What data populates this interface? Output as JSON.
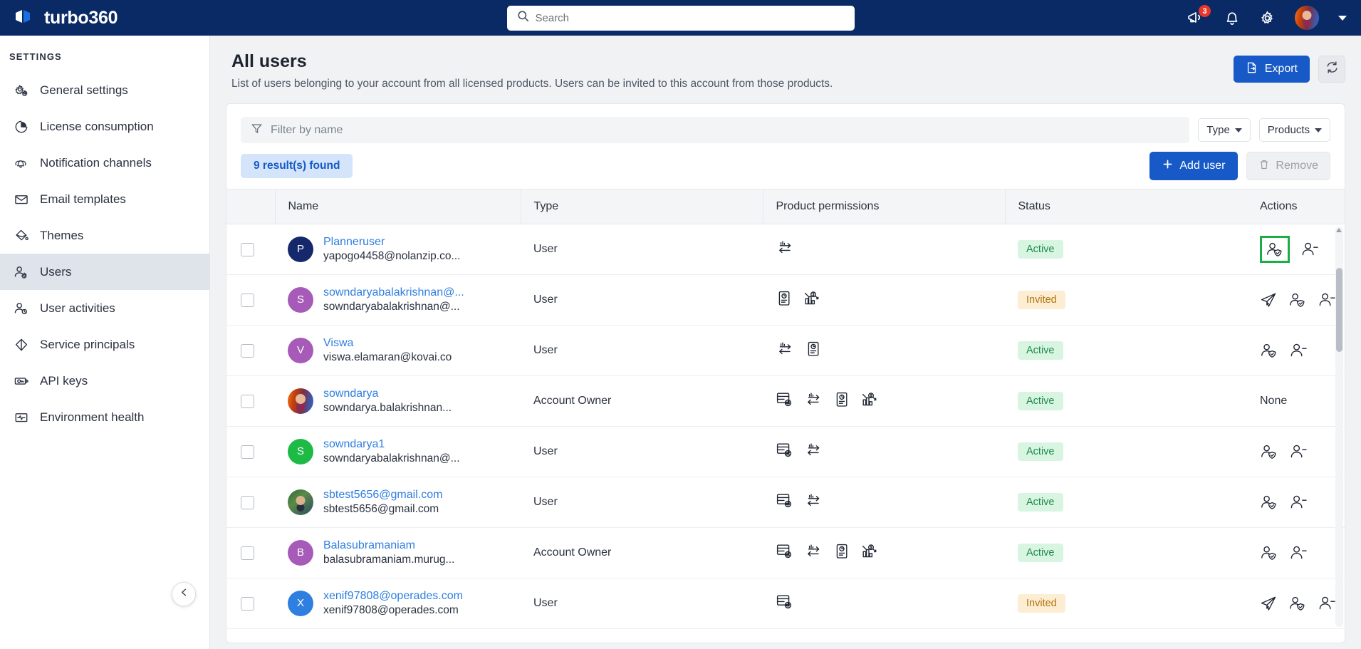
{
  "topbar": {
    "brand": "turbo360",
    "search_placeholder": "Search",
    "announcement_badge": "3"
  },
  "sidebar": {
    "section_label": "SETTINGS",
    "items": [
      {
        "label": "General settings",
        "icon": "gears-icon",
        "active": false
      },
      {
        "label": "License consumption",
        "icon": "pie-chart-icon",
        "active": false
      },
      {
        "label": "Notification channels",
        "icon": "notification-icon",
        "active": false
      },
      {
        "label": "Email templates",
        "icon": "envelope-icon",
        "active": false
      },
      {
        "label": "Themes",
        "icon": "palette-icon",
        "active": false
      },
      {
        "label": "Users",
        "icon": "user-gear-icon",
        "active": true
      },
      {
        "label": "User activities",
        "icon": "user-clock-icon",
        "active": false
      },
      {
        "label": "Service principals",
        "icon": "diamond-icon",
        "active": false
      },
      {
        "label": "API keys",
        "icon": "key-card-icon",
        "active": false
      },
      {
        "label": "Environment health",
        "icon": "health-monitor-icon",
        "active": false
      }
    ]
  },
  "page": {
    "title": "All users",
    "subtitle": "List of users belonging to your account from all licensed products. Users can be invited to this account from those products.",
    "export_label": "Export",
    "refresh_icon": "refresh-icon"
  },
  "filter": {
    "placeholder": "Filter by name",
    "value": "",
    "type_label": "Type",
    "products_label": "Products"
  },
  "toolbar": {
    "result_count": "9 result(s) found",
    "add_user_label": "Add user",
    "remove_label": "Remove"
  },
  "table": {
    "columns": [
      "Name",
      "Type",
      "Product permissions",
      "Status",
      "Actions"
    ],
    "rows": [
      {
        "initial": "P",
        "avatar_color": "#14286b",
        "avatar_kind": "initial",
        "name": "Planneruser",
        "email": "yapogo4458@nolanzip.co...",
        "type": "User",
        "permissions": [
          "integrate-icon"
        ],
        "status": "Active",
        "status_kind": "active",
        "actions": [
          "manage-permissions-icon",
          "remove-user-icon"
        ],
        "highlight_action": 0,
        "actions_text": ""
      },
      {
        "initial": "S",
        "avatar_color": "#a75bb8",
        "avatar_kind": "initial",
        "name": "sowndaryabalakrishnan@...",
        "email": "sowndaryabalakrishnan@...",
        "type": "User",
        "permissions": [
          "document-icon",
          "finops-icon"
        ],
        "status": "Invited",
        "status_kind": "invited",
        "actions": [
          "resend-invite-icon",
          "manage-permissions-icon",
          "remove-user-icon"
        ],
        "highlight_action": -1,
        "actions_text": ""
      },
      {
        "initial": "V",
        "avatar_color": "#a75bb8",
        "avatar_kind": "initial",
        "name": "Viswa",
        "email": "viswa.elamaran@kovai.co",
        "type": "User",
        "permissions": [
          "integrate-icon",
          "document-icon"
        ],
        "status": "Active",
        "status_kind": "active",
        "actions": [
          "manage-permissions-icon",
          "remove-user-icon"
        ],
        "highlight_action": -1,
        "actions_text": ""
      },
      {
        "initial": "",
        "avatar_color": "",
        "avatar_kind": "photo",
        "name": "sowndarya",
        "email": "sowndarya.balakrishnan...",
        "type": "Account Owner",
        "permissions": [
          "bam-icon",
          "integrate-icon",
          "document-icon",
          "finops-icon"
        ],
        "status": "Active",
        "status_kind": "active",
        "actions": [],
        "highlight_action": -1,
        "actions_text": "None"
      },
      {
        "initial": "S",
        "avatar_color": "#1dba45",
        "avatar_kind": "initial",
        "name": "sowndarya1",
        "email": "sowndaryabalakrishnan@...",
        "type": "User",
        "permissions": [
          "bam-icon",
          "integrate-icon"
        ],
        "status": "Active",
        "status_kind": "active",
        "actions": [
          "manage-permissions-icon",
          "remove-user-icon"
        ],
        "highlight_action": -1,
        "actions_text": ""
      },
      {
        "initial": "",
        "avatar_color": "",
        "avatar_kind": "photo2",
        "name": "sbtest5656@gmail.com",
        "email": "sbtest5656@gmail.com",
        "type": "User",
        "permissions": [
          "bam-icon",
          "integrate-icon"
        ],
        "status": "Active",
        "status_kind": "active",
        "actions": [
          "manage-permissions-icon",
          "remove-user-icon"
        ],
        "highlight_action": -1,
        "actions_text": ""
      },
      {
        "initial": "B",
        "avatar_color": "#a75bb8",
        "avatar_kind": "initial",
        "name": "Balasubramaniam",
        "email": "balasubramaniam.murug...",
        "type": "Account Owner",
        "permissions": [
          "bam-icon",
          "integrate-icon",
          "document-icon",
          "finops-icon"
        ],
        "status": "Active",
        "status_kind": "active",
        "actions": [
          "manage-permissions-icon",
          "remove-user-icon"
        ],
        "highlight_action": -1,
        "actions_text": ""
      },
      {
        "initial": "X",
        "avatar_color": "#2f7fe0",
        "avatar_kind": "initial",
        "name": "xenif97808@operades.com",
        "email": "xenif97808@operades.com",
        "type": "User",
        "permissions": [
          "bam-icon"
        ],
        "status": "Invited",
        "status_kind": "invited",
        "actions": [
          "resend-invite-icon",
          "manage-permissions-icon",
          "remove-user-icon"
        ],
        "highlight_action": -1,
        "actions_text": ""
      }
    ]
  }
}
